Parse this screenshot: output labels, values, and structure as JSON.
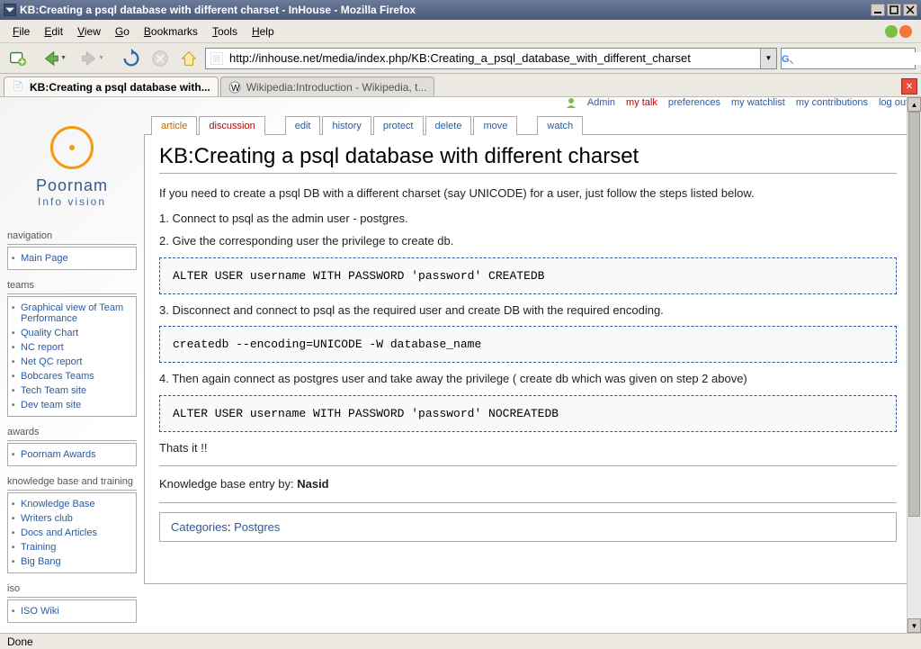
{
  "window": {
    "title": "KB:Creating a psql database with different charset - InHouse - Mozilla Firefox"
  },
  "menubar": [
    "File",
    "Edit",
    "View",
    "Go",
    "Bookmarks",
    "Tools",
    "Help"
  ],
  "url": "http://inhouse.net/media/index.php/KB:Creating_a_psql_database_with_different_charset",
  "browser_tabs": [
    {
      "title": "KB:Creating a psql database with...",
      "active": true
    },
    {
      "title": "Wikipedia:Introduction - Wikipedia, t...",
      "active": false
    }
  ],
  "logo": {
    "name": "Poornam",
    "sub": "Info vision"
  },
  "sidebar": [
    {
      "title": "navigation",
      "items": [
        "Main Page"
      ]
    },
    {
      "title": "teams",
      "items": [
        "Graphical view of Team Performance",
        "Quality Chart",
        "NC report",
        "Net QC report",
        "Bobcares Teams",
        "Tech Team site",
        "Dev team site"
      ]
    },
    {
      "title": "awards",
      "items": [
        "Poornam Awards"
      ]
    },
    {
      "title": "knowledge base and training",
      "items": [
        "Knowledge Base",
        "Writers club",
        "Docs and Articles",
        "Training",
        "Big Bang"
      ]
    },
    {
      "title": "iso",
      "items": [
        "ISO Wiki"
      ]
    }
  ],
  "user_links": {
    "user": "Admin",
    "talk": "my talk",
    "prefs": "preferences",
    "watchlist": "my watchlist",
    "contribs": "my contributions",
    "logout": "log out"
  },
  "page_tabs": {
    "article": "article",
    "discussion": "discussion",
    "edit": "edit",
    "history": "history",
    "protect": "protect",
    "delete": "delete",
    "move": "move",
    "watch": "watch"
  },
  "article": {
    "title": "KB:Creating a psql database with different charset",
    "intro": "If you need to create a psql DB with a different charset (say UNICODE) for a user, just follow the steps listed below.",
    "step1": "1. Connect to psql as the admin user - postgres.",
    "step2": "2. Give the corresponding user the privilege to create db.",
    "code1": "ALTER USER username WITH PASSWORD 'password' CREATEDB",
    "step3": "3. Disconnect and connect to psql as the required user and create DB with the required encoding.",
    "code2": "createdb --encoding=UNICODE -W database_name",
    "step4": "4. Then again connect as postgres user and take away the privilege ( create db which was given on step 2 above)",
    "code3": "ALTER USER username WITH PASSWORD 'password' NOCREATEDB",
    "outro": "Thats it !!",
    "byline_label": "Knowledge base entry by: ",
    "byline_author": "Nasid",
    "cat_label": "Categories",
    "cat_value": "Postgres"
  },
  "status": "Done"
}
